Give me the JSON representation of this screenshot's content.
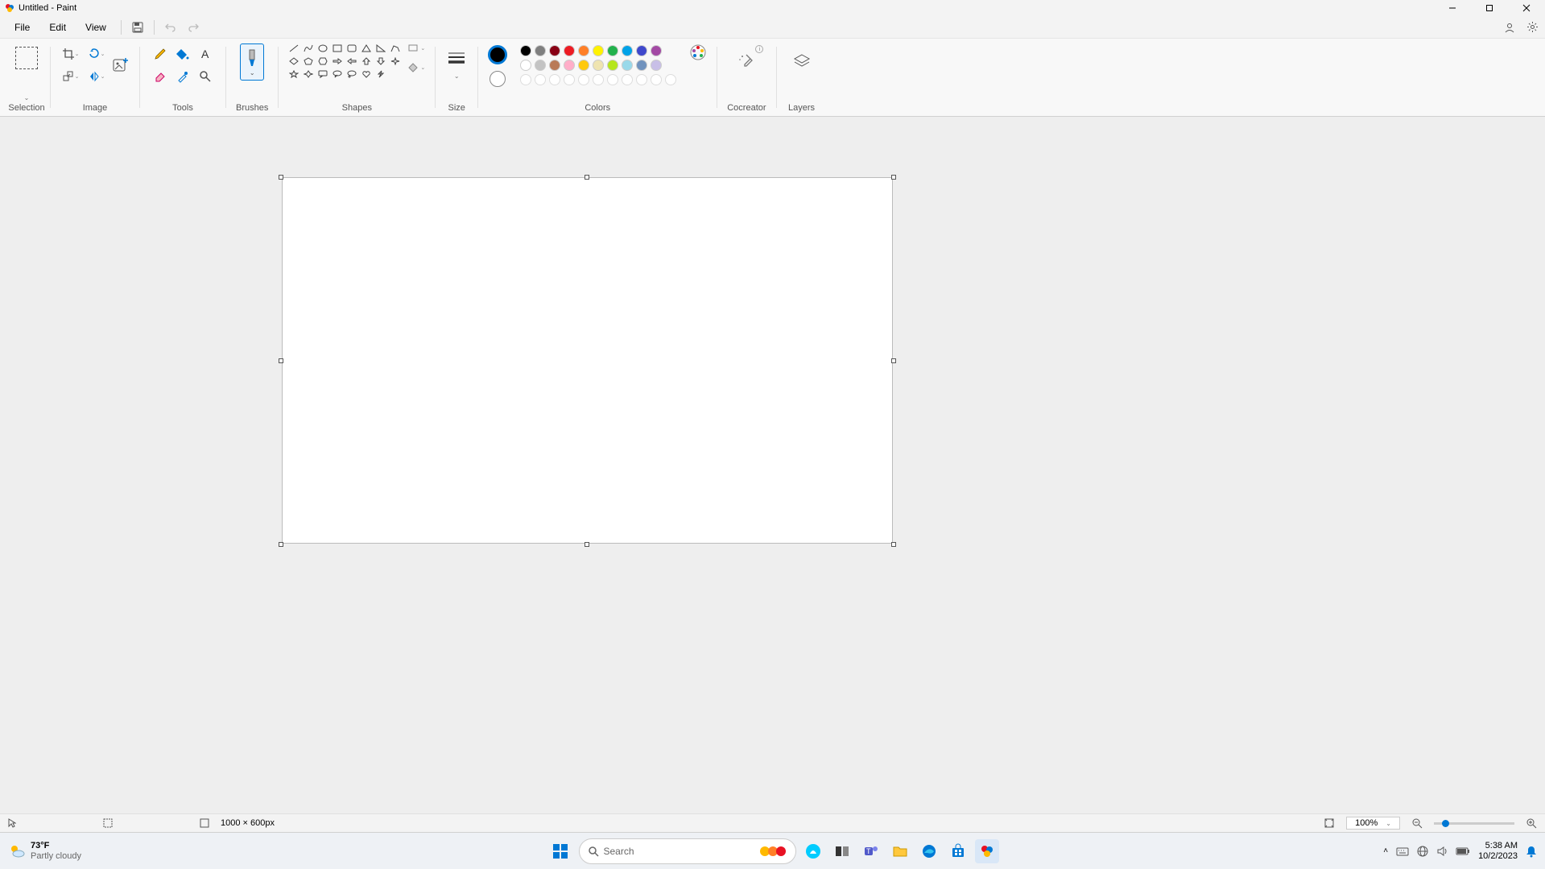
{
  "window": {
    "title": "Untitled - Paint"
  },
  "menu": {
    "file": "File",
    "edit": "Edit",
    "view": "View"
  },
  "ribbon": {
    "selection": "Selection",
    "image": "Image",
    "tools": "Tools",
    "brushes": "Brushes",
    "shapes": "Shapes",
    "size": "Size",
    "colors": "Colors",
    "cocreator": "Cocreator",
    "layers": "Layers"
  },
  "colors": {
    "primary": "#000000",
    "secondary": "#ffffff",
    "row1": [
      "#000000",
      "#7f7f7f",
      "#880015",
      "#ed1c24",
      "#ff7f27",
      "#fff200",
      "#22b14c",
      "#00a2e8",
      "#3f48cc",
      "#a349a4"
    ],
    "row2": [
      "#ffffff",
      "#c3c3c3",
      "#b97a57",
      "#ffaec9",
      "#ffc90e",
      "#efe4b0",
      "#b5e61d",
      "#99d9ea",
      "#7092be",
      "#c8bfe7"
    ]
  },
  "canvas": {
    "dimensions": "1000 × 600px"
  },
  "zoom": {
    "value": "100%"
  },
  "taskbar": {
    "search_placeholder": "Search",
    "weather_temp": "73°F",
    "weather_cond": "Partly cloudy",
    "time": "5:38 AM",
    "date": "10/2/2023"
  }
}
